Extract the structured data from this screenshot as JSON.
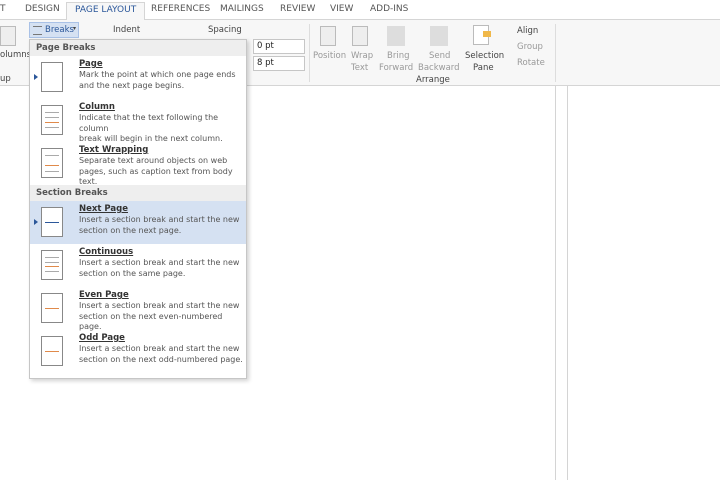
{
  "tabs": [
    "T",
    "DESIGN",
    "PAGE LAYOUT",
    "REFERENCES",
    "MAILINGS",
    "REVIEW",
    "VIEW",
    "ADD-INS"
  ],
  "ribbon": {
    "columns": "olumns",
    "group_label": "up",
    "breaks": "Breaks",
    "indent": "Indent",
    "spacing": "Spacing",
    "spacing_before": "0 pt",
    "spacing_after": "8 pt",
    "position": "Position",
    "wrap_text": [
      "Wrap",
      "Text"
    ],
    "bring_forward": [
      "Bring",
      "Forward"
    ],
    "send_backward": [
      "Send",
      "Backward"
    ],
    "selection_pane": [
      "Selection",
      "Pane"
    ],
    "align": "Align",
    "group": "Group",
    "rotate": "Rotate",
    "arrange": "Arrange"
  },
  "menu": {
    "page_breaks_header": "Page Breaks",
    "section_breaks_header": "Section Breaks",
    "page_items": [
      {
        "title": "Page",
        "desc": [
          "Mark the point at which one page ends",
          "and the next page begins."
        ]
      },
      {
        "title": "Column",
        "desc": [
          "Indicate that the text following the column",
          "break will begin in the next column."
        ]
      },
      {
        "title": "Text Wrapping",
        "desc": [
          "Separate text around objects on web",
          "pages, such as caption text from body text."
        ]
      }
    ],
    "section_items": [
      {
        "title": "Next Page",
        "desc": [
          "Insert a section break and start the new",
          "section on the next page."
        ]
      },
      {
        "title": "Continuous",
        "desc": [
          "Insert a section break and start the new",
          "section on the same page."
        ]
      },
      {
        "title": "Even Page",
        "desc": [
          "Insert a section break and start the new",
          "section on the next even-numbered page."
        ]
      },
      {
        "title": "Odd Page",
        "desc": [
          "Insert a section break and start the new",
          "section on the next odd-numbered page."
        ]
      }
    ]
  }
}
